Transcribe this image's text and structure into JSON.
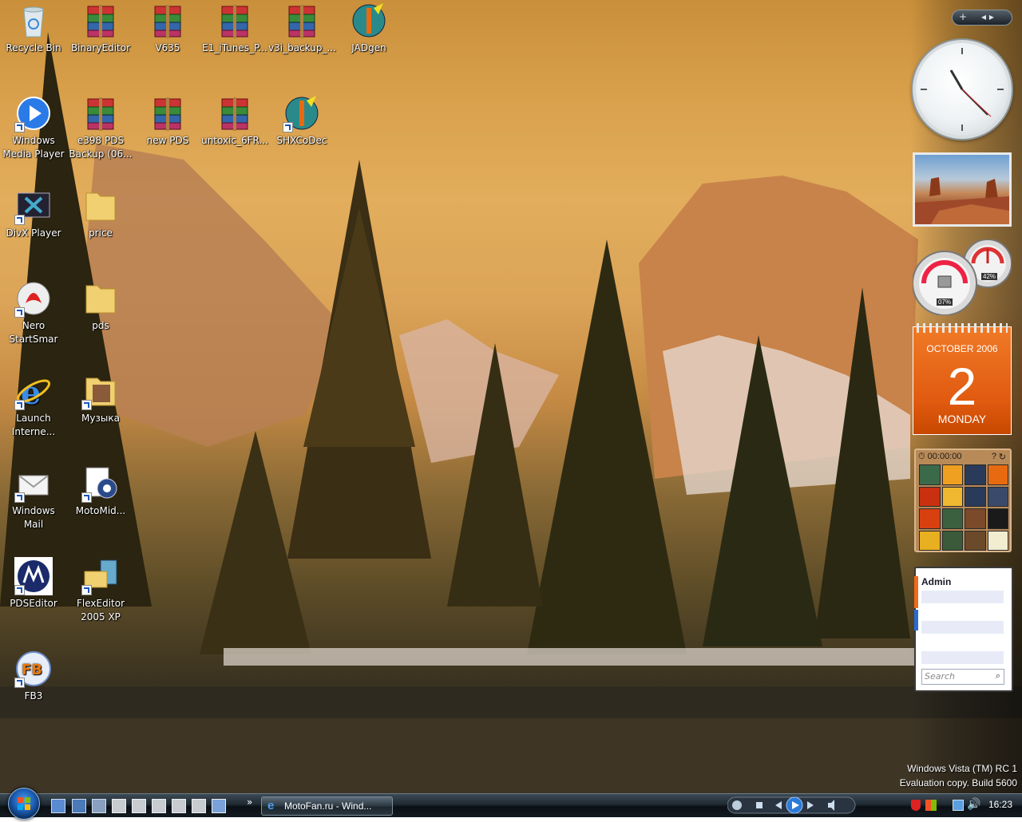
{
  "desktop": {
    "icons": [
      {
        "id": "recycle-bin",
        "label": "Recycle Bin",
        "icon": "recycle-bin-icon"
      },
      {
        "id": "binary-editor",
        "label": "BinaryEditor",
        "icon": "rar-archive-icon"
      },
      {
        "id": "v635",
        "label": "V635",
        "icon": "rar-archive-icon"
      },
      {
        "id": "e1-itunes",
        "label": "E1_iTunes_P...",
        "icon": "rar-archive-icon"
      },
      {
        "id": "v3i-backup",
        "label": "v3i_backup_...",
        "icon": "rar-archive-icon"
      },
      {
        "id": "jadgen",
        "label": "JADgen",
        "icon": "java-tool-icon"
      },
      {
        "id": "windows-media-player",
        "label": "Windows\nMedia Player",
        "icon": "media-player-icon"
      },
      {
        "id": "e398-pds",
        "label": "e398 PDS\nBackup (06...",
        "icon": "rar-archive-icon"
      },
      {
        "id": "new-pds",
        "label": "new PDS",
        "icon": "rar-archive-icon"
      },
      {
        "id": "untoxic",
        "label": "untoxic_6FR...",
        "icon": "rar-archive-icon"
      },
      {
        "id": "shxcodec",
        "label": "SHXCoDec",
        "icon": "java-tool-icon"
      },
      {
        "id": "divx-player",
        "label": "DivX Player",
        "icon": "divx-icon"
      },
      {
        "id": "price",
        "label": "price",
        "icon": "folder-icon"
      },
      {
        "id": "nero",
        "label": "Nero\nStartSmar",
        "icon": "nero-icon"
      },
      {
        "id": "pds",
        "label": "pds",
        "icon": "folder-icon"
      },
      {
        "id": "launch-ie",
        "label": "Launch\nInterne...",
        "icon": "internet-explorer-icon"
      },
      {
        "id": "muzyka",
        "label": "Музыка",
        "icon": "music-folder-icon"
      },
      {
        "id": "windows-mail",
        "label": "Windows\nMail",
        "icon": "mail-icon"
      },
      {
        "id": "motomid",
        "label": "MotoMid...",
        "icon": "motomid-icon"
      },
      {
        "id": "pdseditor",
        "label": "PDSEditor",
        "icon": "motorola-icon"
      },
      {
        "id": "flexeditor",
        "label": "FlexEditor\n2005 XP",
        "icon": "flexeditor-icon"
      },
      {
        "id": "fb3",
        "label": "FB3",
        "icon": "fb3-icon"
      }
    ]
  },
  "sidebar": {
    "add_label": "+",
    "nav_label": "◂ ▸",
    "cpu": {
      "cpu_percent_label": "07%",
      "memory_percent_label": "42%",
      "cpu_percent": 7,
      "memory_percent": 42
    },
    "calendar": {
      "month": "OCTOBER 2006",
      "day": "2",
      "weekday": "MONDAY"
    },
    "puzzle": {
      "timer": "00:00:00"
    },
    "contacts": {
      "title": "Admin",
      "search_placeholder": "Search"
    }
  },
  "watermark": {
    "line1": "Windows Vista (TM) RC 1",
    "line2": "Evaluation copy. Build 5600"
  },
  "taskbar": {
    "task_button": "MotoFan.ru - Wind...",
    "more_label": "»",
    "clock": "16:23"
  },
  "colors": {
    "calendar_orange": "#e86418",
    "taskbar_dark": "#141c22",
    "accent_blue": "#1c5db3"
  }
}
